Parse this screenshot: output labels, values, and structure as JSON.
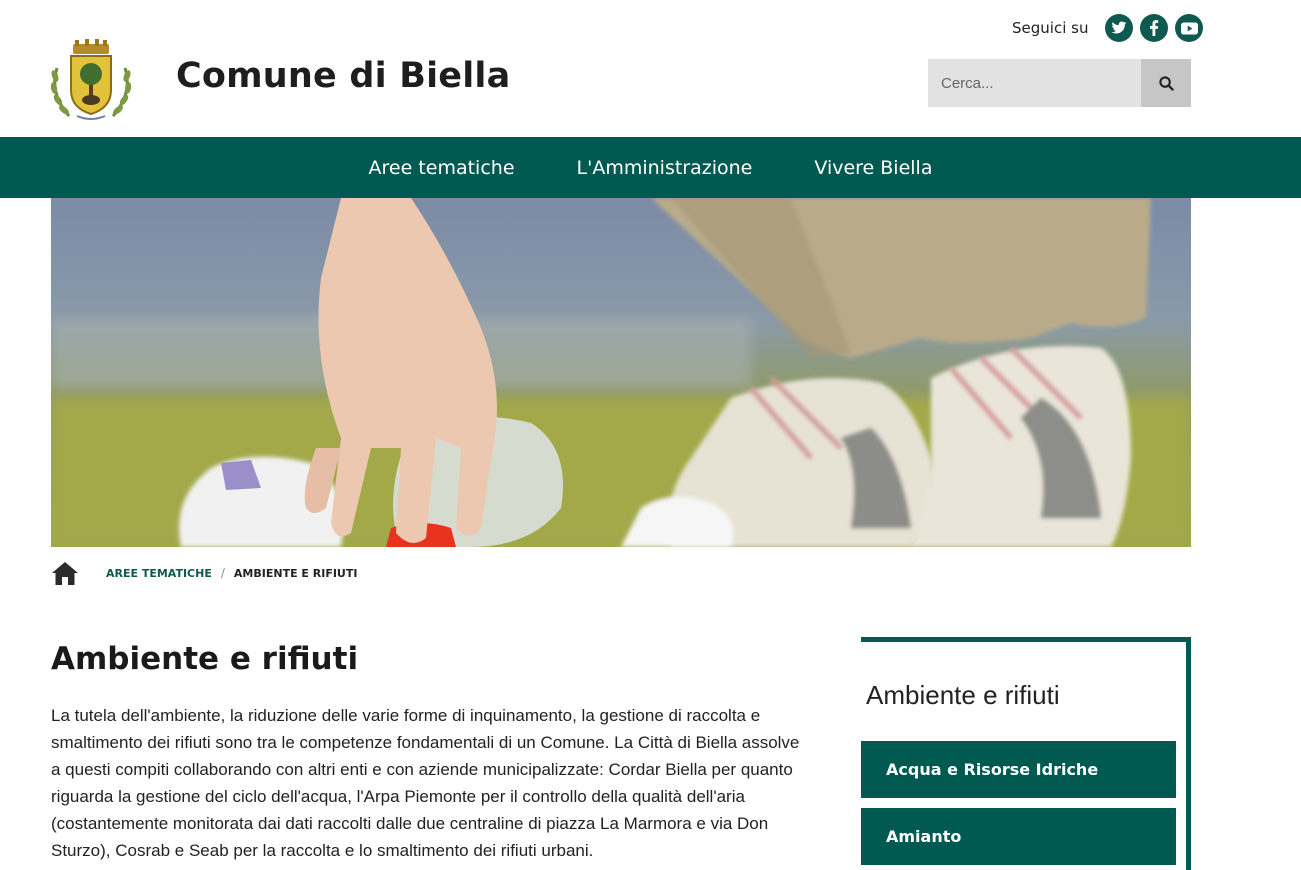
{
  "header": {
    "site_title": "Comune di Biella",
    "social_label": "Seguici su",
    "social_icons": [
      "twitter-icon",
      "facebook-icon",
      "youtube-icon"
    ],
    "search_placeholder": "Cerca..."
  },
  "nav": {
    "items": [
      {
        "label": "Aree tematiche"
      },
      {
        "label": "L'Amministrazione"
      },
      {
        "label": "Vivere Biella"
      }
    ]
  },
  "breadcrumb": {
    "link": "Aree tematiche",
    "separator": "/",
    "current": "Ambiente e rifiuti"
  },
  "main": {
    "title": "Ambiente e rifiuti",
    "intro": "La tutela dell'ambiente, la riduzione delle varie forme di inquinamento, la gestione di raccolta e smaltimento dei rifiuti sono tra le competenze fondamentali di un Comune. La Città di Biella assolve a questi compiti collaborando con altri enti e con aziende municipalizzate: Cordar Biella per quanto riguarda la gestione del ciclo dell'acqua, l'Arpa Piemonte per il controllo della qualità dell'aria (costantemente monitorata dai dati raccolti dalle due centraline di piazza La Marmora e via Don Sturzo), Cosrab e Seab per la raccolta e lo smaltimento dei rifiuti urbani."
  },
  "sidebar": {
    "title": "Ambiente e rifiuti",
    "links": [
      {
        "label": "Acqua e Risorse Idriche"
      },
      {
        "label": "Amianto"
      }
    ]
  },
  "colors": {
    "brand_green": "#005a52",
    "search_bg": "#e2e2e2",
    "search_button": "#c6c6c6"
  }
}
